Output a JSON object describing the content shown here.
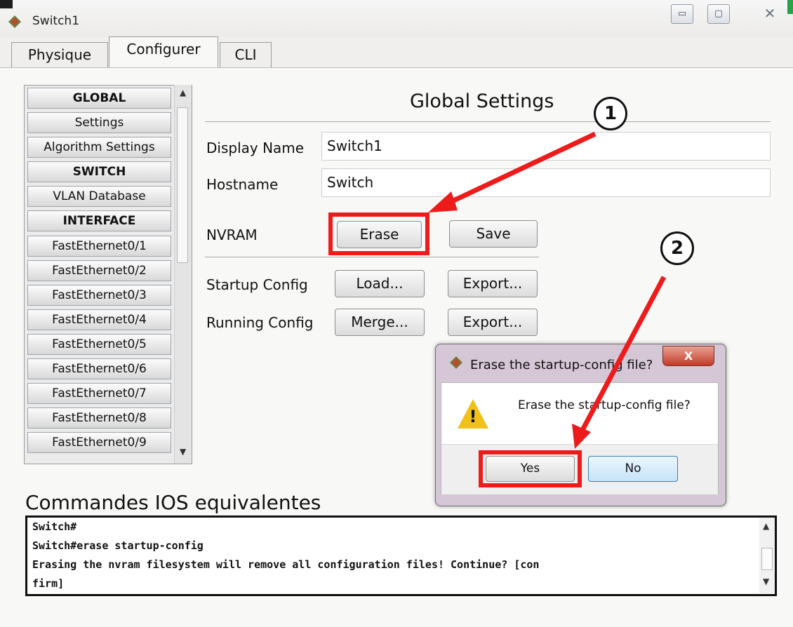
{
  "window": {
    "title": "Switch1",
    "controls": {
      "minimize": "▭",
      "maximize": "▢",
      "close": "✕"
    }
  },
  "tabs": [
    {
      "label": "Physique"
    },
    {
      "label": "Configurer",
      "active": true
    },
    {
      "label": "CLI"
    }
  ],
  "sidebar": {
    "items": [
      {
        "label": "GLOBAL",
        "bold": true
      },
      {
        "label": "Settings"
      },
      {
        "label": "Algorithm Settings"
      },
      {
        "label": "SWITCH",
        "bold": true
      },
      {
        "label": "VLAN Database"
      },
      {
        "label": "INTERFACE",
        "bold": true
      },
      {
        "label": "FastEthernet0/1"
      },
      {
        "label": "FastEthernet0/2"
      },
      {
        "label": "FastEthernet0/3"
      },
      {
        "label": "FastEthernet0/4"
      },
      {
        "label": "FastEthernet0/5"
      },
      {
        "label": "FastEthernet0/6"
      },
      {
        "label": "FastEthernet0/7"
      },
      {
        "label": "FastEthernet0/8"
      },
      {
        "label": "FastEthernet0/9"
      }
    ]
  },
  "settings": {
    "title": "Global Settings",
    "display_name_label": "Display Name",
    "display_name_value": "Switch1",
    "hostname_label": "Hostname",
    "hostname_value": "Switch",
    "nvram_label": "NVRAM",
    "erase_button": "Erase",
    "save_button": "Save",
    "startup_label": "Startup Config",
    "load_button": "Load...",
    "export_button": "Export...",
    "running_label": "Running Config",
    "merge_button": "Merge...",
    "export2_button": "Export..."
  },
  "console": {
    "title": "Commandes IOS equivalentes",
    "lines": [
      "Switch#",
      "Switch#erase startup-config",
      "Erasing the nvram filesystem will remove all configuration files! Continue? [con",
      "firm]"
    ]
  },
  "dialog": {
    "title": "Erase the startup-config file?",
    "message": "Erase the startup-config file?",
    "yes_button": "Yes",
    "no_button": "No",
    "close": "X"
  },
  "annotations": {
    "step1": "1",
    "step2": "2",
    "color": "#ee1b1b"
  }
}
